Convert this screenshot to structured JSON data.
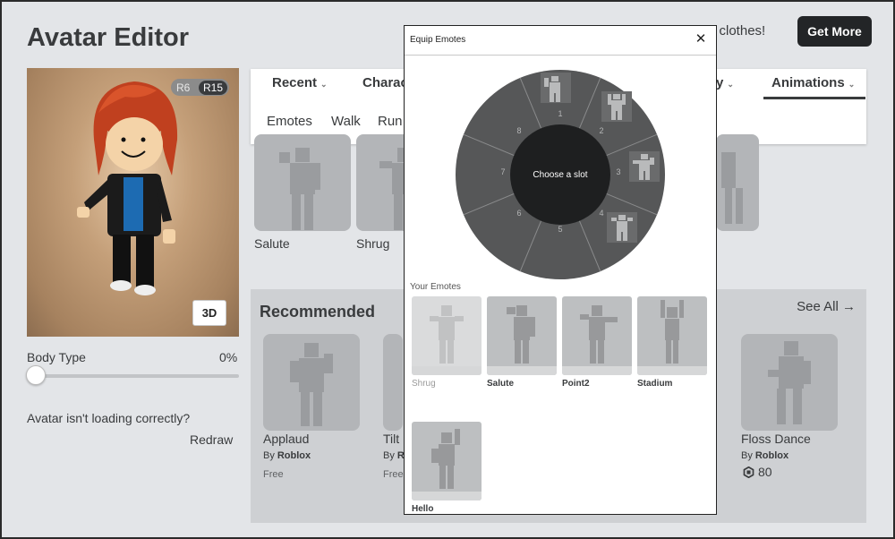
{
  "page": {
    "title": "Avatar Editor",
    "promo_text": "re clothes!",
    "get_more_label": "Get More"
  },
  "preview": {
    "rig_r6": "R6",
    "rig_r15": "R15",
    "btn_3d": "3D"
  },
  "body_type": {
    "label": "Body Type",
    "value_text": "0%",
    "value": 0
  },
  "loading_help": {
    "question": "Avatar isn't loading correctly?",
    "redraw_label": "Redraw"
  },
  "nav": {
    "categories": [
      "Recent",
      "Charac",
      "y",
      "Animations"
    ],
    "subcategories": [
      "Emotes",
      "Walk",
      "Run"
    ]
  },
  "owned": {
    "items": [
      "Salute",
      "Shrug"
    ]
  },
  "recommended": {
    "title": "Recommended",
    "see_all": "See All",
    "items": [
      {
        "name": "Applaud",
        "by": "By",
        "creator": "Roblox",
        "price": "Free"
      },
      {
        "name": "Tilt",
        "by": "By",
        "creator": "R",
        "price": "Free"
      },
      {
        "name": "Floss Dance",
        "by": "By",
        "creator": "Roblox",
        "price": "80"
      }
    ]
  },
  "modal": {
    "title": "Equip Emotes",
    "center_label": "Choose a slot",
    "slot_numbers": [
      "1",
      "2",
      "3",
      "4",
      "5",
      "6",
      "7",
      "8"
    ],
    "your_emotes_label": "Your Emotes",
    "emotes": [
      {
        "name": "Shrug",
        "equipped": true
      },
      {
        "name": "Salute",
        "equipped": false
      },
      {
        "name": "Point2",
        "equipped": false
      },
      {
        "name": "Stadium",
        "equipped": false
      },
      {
        "name": "Hello",
        "equipped": false
      }
    ]
  },
  "colors": {
    "wheel": "#565758",
    "wheel_center": "#1e1f20",
    "card": "#b3b5b8",
    "dark_button": "#232527"
  },
  "icons": {
    "close": "close-icon",
    "chevron": "chevron-down-icon",
    "arrow": "arrow-right-icon",
    "robux": "robux-icon"
  }
}
